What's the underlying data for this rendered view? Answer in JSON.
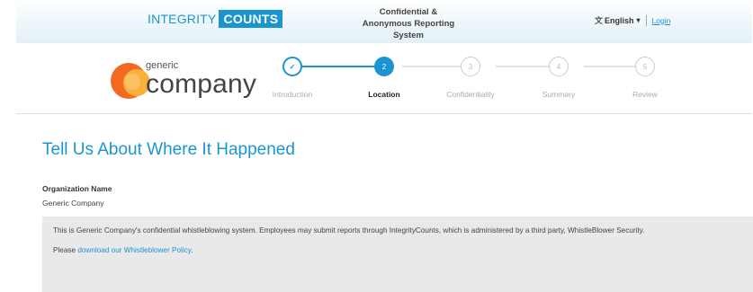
{
  "header": {
    "logo_part1": "INTEGRITY",
    "logo_part2": "COUNTS",
    "system_title": "Confidential & Anonymous Reporting System",
    "language": "English",
    "language_caret": "▾",
    "login_label": "Login"
  },
  "company": {
    "name_small": "generic",
    "name_big": "company"
  },
  "steps": {
    "items": [
      {
        "number": "✓",
        "label": "Introduction",
        "state": "done"
      },
      {
        "number": "2",
        "label": "Location",
        "state": "active"
      },
      {
        "number": "3",
        "label": "Confidentiality",
        "state": "todo"
      },
      {
        "number": "4",
        "label": "Summary",
        "state": "todo"
      },
      {
        "number": "5",
        "label": "Review",
        "state": "todo"
      }
    ]
  },
  "main": {
    "heading": "Tell Us About Where It Happened",
    "org_label": "Organization Name",
    "org_value": "Generic Company",
    "notice_text": "This is Generic Company's confidential whistleblowing system. Employees may submit reports through IntegrityCounts, which is administered by a third party, WhistleBlower Security.",
    "policy_prefix": "Please ",
    "policy_link": "download our Whistleblower Policy",
    "policy_suffix": "."
  },
  "colors": {
    "accent": "#1b95cf",
    "logo_orange": "#f26a21",
    "logo_yellow": "#fbb03b",
    "notice_bg": "#e9e9e9"
  },
  "icons": {
    "language": "translate-icon",
    "step_done": "checkmark-icon"
  }
}
